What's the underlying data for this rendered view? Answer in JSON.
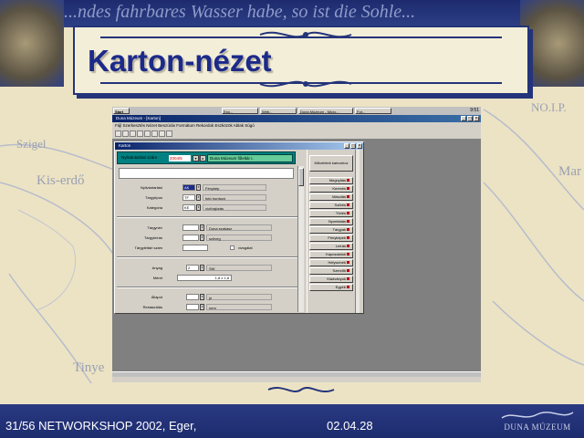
{
  "slide": {
    "banner_text": "...ndes fahrbares Wasser habe, so ist die Sohle...",
    "title": "Karton-nézet",
    "map_labels": [
      "Szigel",
      "Kis-erdő",
      "Tinye",
      "Mar",
      "NO.I.P."
    ],
    "footer_left": "31/56 NETWORKSHOP 2002, Eger,",
    "footer_date": "02.04.28",
    "footer_logo": "DUNA MÚZEUM",
    "colors": {
      "navy": "#1c2a8a",
      "banner": "#1d2b6e",
      "paper": "#ece3c4"
    }
  },
  "screenshot": {
    "taskbar": {
      "start_label": "Start",
      "buttons": [
        "Exp...",
        "Web...",
        "Duna Múzeum - Micro...",
        "Fot..."
      ],
      "clock": "9:51"
    },
    "app_title": "Duna Múzeum - [Karton]",
    "menu": "Fájl  Szerkesztés  Nézet  Beszúrás  Formátum  Rekordok  Eszközök  Ablak  Súgó",
    "toolbar_icons": [
      "save-icon",
      "print-icon",
      "cut-icon",
      "copy-icon",
      "paste-icon",
      "undo-icon",
      "filter-icon",
      "help-icon"
    ],
    "form": {
      "title": "Karton",
      "header_label": "Nyilvántartási szám",
      "header_value": "2004/5",
      "header_field": "Duna Múzeum főleltár I.",
      "fields": [
        {
          "label": "Nyilvántartási",
          "value": "AK",
          "desc": "Fénykép"
        },
        {
          "label": "Tárgytípus",
          "value": "TF",
          "desc": "fotó hordozó"
        },
        {
          "label": "Kategória",
          "value": "KE",
          "desc": "víz/hajózás"
        },
        {
          "label": "Tárgynév",
          "value": "",
          "desc": "Duna szakasz"
        },
        {
          "label": "Tárgyleírás",
          "value": "",
          "desc": "szöveg"
        },
        {
          "label": "Tárgyleltári szám",
          "value": "",
          "desc": "vizsgálat"
        },
        {
          "label": "Anyag",
          "value": "2",
          "desc": "SW"
        },
        {
          "label": "Méret",
          "value": "",
          "desc": "1,8 x 1,8"
        },
        {
          "label": "Állapot",
          "value": "",
          "desc": "jó"
        },
        {
          "label": "Restaurálás",
          "value": "",
          "desc": "nem"
        }
      ]
    },
    "side_panel": {
      "top_button": "Műveletek kartonhoz",
      "buttons": [
        "Megnyitás",
        "Keresés",
        "Másolás",
        "Szűrés",
        "Törlés",
        "Nyomtatás",
        "Tárgyak",
        "Fényképek",
        "Leírás",
        "Kapcsolatok",
        "Helyszínek",
        "Szerzők",
        "Kiadványok",
        "Egyéb"
      ]
    }
  }
}
